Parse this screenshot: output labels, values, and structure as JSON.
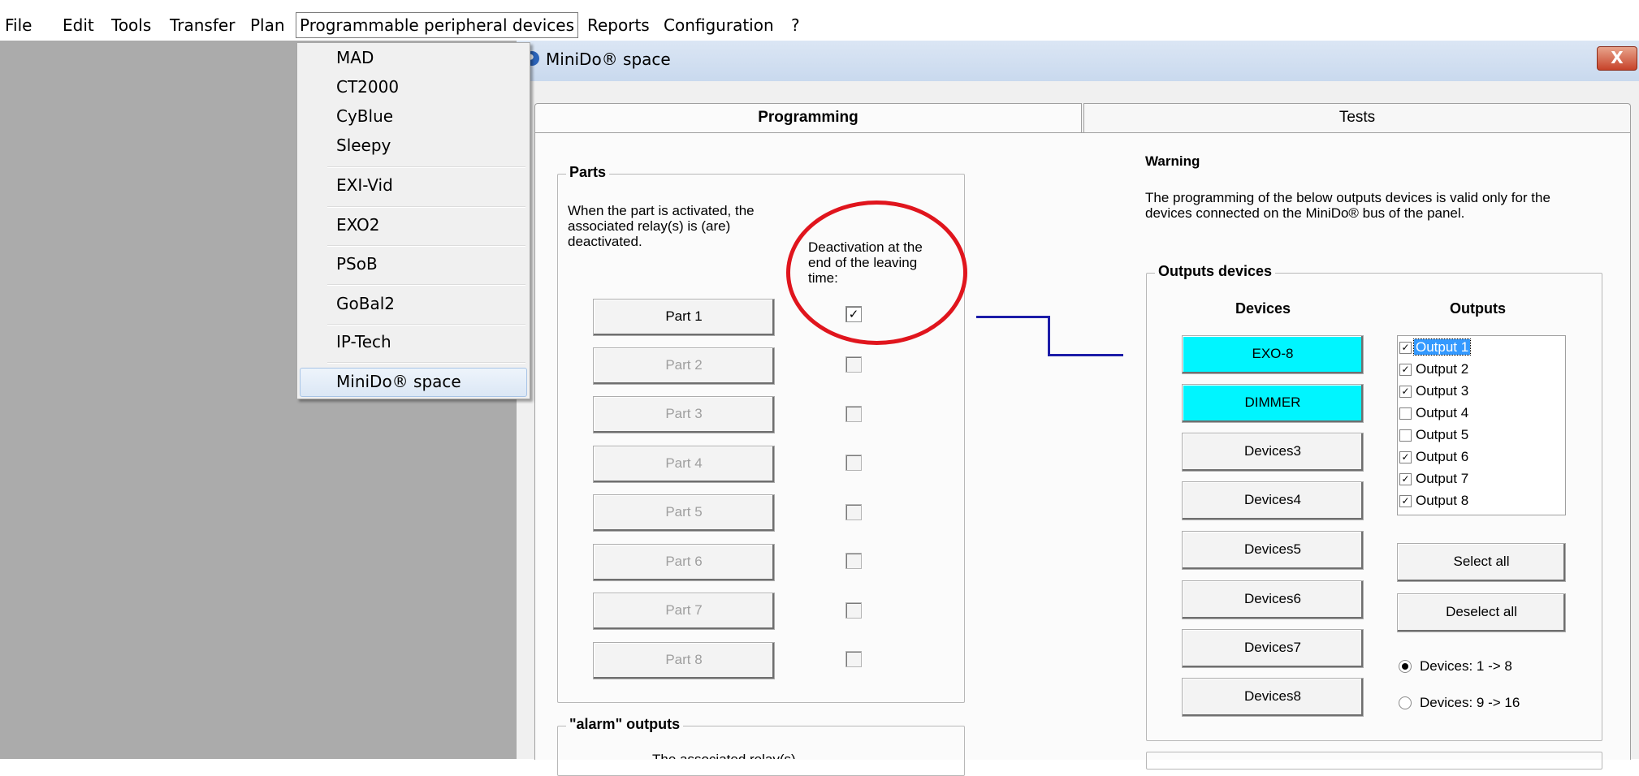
{
  "menubar": {
    "items": [
      "File",
      "Edit",
      "Tools",
      "Transfer",
      "Plan",
      "Programmable peripheral devices",
      "Reports",
      "Configuration",
      "?"
    ]
  },
  "dropdown": {
    "items": [
      "MAD",
      "CT2000",
      "CyBlue",
      "Sleepy",
      "EXI-Vid",
      "EXO2",
      "PSoB",
      "GoBal2",
      "IP-Tech",
      "MiniDo® space"
    ],
    "highlighted": "MiniDo® space"
  },
  "window": {
    "title": "MiniDo® space",
    "close_label": "X"
  },
  "tabs": {
    "programming": "Programming",
    "tests": "Tests"
  },
  "parts": {
    "legend": "Parts",
    "description": "When the part is activated, the associated relay(s) is (are) deactivated.",
    "column_header": "Deactivation at the end of the leaving time:",
    "rows": [
      {
        "label": "Part 1",
        "enabled": true,
        "checked": true,
        "mark": "✓"
      },
      {
        "label": "Part 2",
        "enabled": false,
        "checked": false,
        "mark": ""
      },
      {
        "label": "Part 3",
        "enabled": false,
        "checked": false,
        "mark": ""
      },
      {
        "label": "Part 4",
        "enabled": false,
        "checked": false,
        "mark": ""
      },
      {
        "label": "Part 5",
        "enabled": false,
        "checked": false,
        "mark": ""
      },
      {
        "label": "Part 6",
        "enabled": false,
        "checked": false,
        "mark": ""
      },
      {
        "label": "Part 7",
        "enabled": false,
        "checked": false,
        "mark": ""
      },
      {
        "label": "Part 8",
        "enabled": false,
        "checked": false,
        "mark": ""
      }
    ]
  },
  "alarm_outputs": {
    "legend": "\"alarm\" outputs",
    "text": "The associated relay(s)..."
  },
  "warning": {
    "title": "Warning",
    "text": "The programming of the below outputs devices is valid only for the devices connected on the MiniDo® bus of the panel."
  },
  "outputs_devices": {
    "legend": "Outputs devices",
    "devices_header": "Devices",
    "outputs_header": "Outputs",
    "devices": [
      {
        "label": "EXO-8",
        "active": true
      },
      {
        "label": "DIMMER",
        "active": true
      },
      {
        "label": "Devices3",
        "active": false
      },
      {
        "label": "Devices4",
        "active": false
      },
      {
        "label": "Devices5",
        "active": false
      },
      {
        "label": "Devices6",
        "active": false
      },
      {
        "label": "Devices7",
        "active": false
      },
      {
        "label": "Devices8",
        "active": false
      }
    ],
    "outputs": [
      {
        "label": "Output 1",
        "checked": true,
        "selected": true
      },
      {
        "label": "Output 2",
        "checked": true,
        "selected": false
      },
      {
        "label": "Output 3",
        "checked": true,
        "selected": false
      },
      {
        "label": "Output 4",
        "checked": false,
        "selected": false
      },
      {
        "label": "Output 5",
        "checked": false,
        "selected": false
      },
      {
        "label": "Output 6",
        "checked": true,
        "selected": false
      },
      {
        "label": "Output 7",
        "checked": true,
        "selected": false
      },
      {
        "label": "Output 8",
        "checked": true,
        "selected": false
      }
    ],
    "select_all": "Select all",
    "deselect_all": "Deselect all",
    "ranges": [
      {
        "label": "Devices: 1 -> 8",
        "selected": true
      },
      {
        "label": "Devices: 9 -> 16",
        "selected": false
      }
    ]
  },
  "colors": {
    "active_device": "#00f5ff",
    "annotation": "#e0151d",
    "connector": "#1c1ca8",
    "selection": "#3399ff"
  }
}
